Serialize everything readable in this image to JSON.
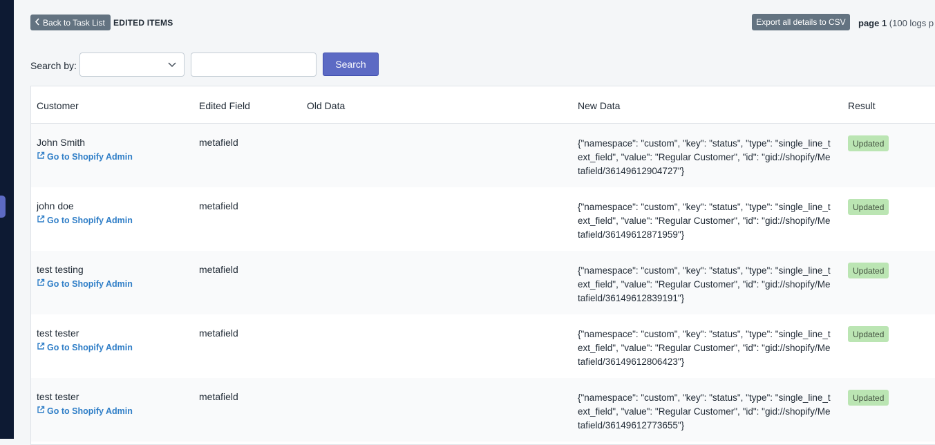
{
  "header": {
    "back_label": "Back to Task List",
    "title": "EDITED ITEMS",
    "export_label": "Export all details to CSV",
    "page_label": "page 1",
    "page_rest": " (100 logs p"
  },
  "search": {
    "label": "Search by:",
    "selected": "",
    "query": "",
    "button_label": "Search"
  },
  "table": {
    "columns": [
      "Customer",
      "Edited Field",
      "Old Data",
      "New Data",
      "Result"
    ],
    "link_label": "Go to Shopify Admin",
    "rows": [
      {
        "customer": "John Smith",
        "field": "metafield",
        "old": "",
        "new": "{\"namespace\": \"custom\", \"key\": \"status\", \"type\": \"single_line_text_field\", \"value\": \"Regular Customer\", \"id\": \"gid://shopify/Metafield/36149612904727\"}",
        "result": "Updated"
      },
      {
        "customer": "john doe",
        "field": "metafield",
        "old": "",
        "new": "{\"namespace\": \"custom\", \"key\": \"status\", \"type\": \"single_line_text_field\", \"value\": \"Regular Customer\", \"id\": \"gid://shopify/Metafield/36149612871959\"}",
        "result": "Updated"
      },
      {
        "customer": "test testing",
        "field": "metafield",
        "old": "",
        "new": "{\"namespace\": \"custom\", \"key\": \"status\", \"type\": \"single_line_text_field\", \"value\": \"Regular Customer\", \"id\": \"gid://shopify/Metafield/36149612839191\"}",
        "result": "Updated"
      },
      {
        "customer": "test tester",
        "field": "metafield",
        "old": "",
        "new": "{\"namespace\": \"custom\", \"key\": \"status\", \"type\": \"single_line_text_field\", \"value\": \"Regular Customer\", \"id\": \"gid://shopify/Metafield/36149612806423\"}",
        "result": "Updated"
      },
      {
        "customer": "test tester",
        "field": "metafield",
        "old": "",
        "new": "{\"namespace\": \"custom\", \"key\": \"status\", \"type\": \"single_line_text_field\", \"value\": \"Regular Customer\", \"id\": \"gid://shopify/Metafield/36149612773655\"}",
        "result": "Updated"
      }
    ]
  },
  "colors": {
    "primary": "#5c6ac4",
    "secondary_button": "#637381",
    "link": "#2f7ec7",
    "success_badge": "#bbe5b3"
  }
}
